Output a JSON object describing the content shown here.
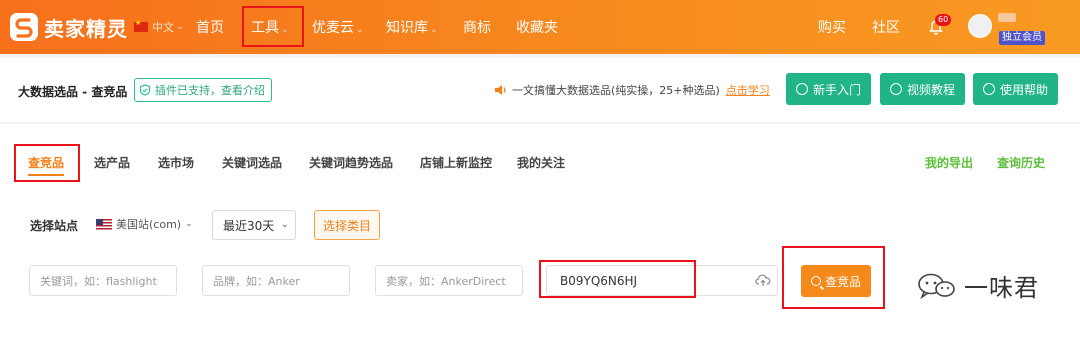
{
  "brand": {
    "name": "卖家精灵"
  },
  "topnav": {
    "language": "中文",
    "items": [
      {
        "label": "首页",
        "has_caret": false
      },
      {
        "label": "工具",
        "has_caret": true
      },
      {
        "label": "优麦云",
        "has_caret": true
      },
      {
        "label": "知识库",
        "has_caret": true
      },
      {
        "label": "商标",
        "has_caret": false
      },
      {
        "label": "收藏夹",
        "has_caret": false
      }
    ],
    "right_items": [
      {
        "label": "购买"
      },
      {
        "label": "社区"
      }
    ],
    "notification_count": "60",
    "member_tag": "独立会员"
  },
  "subheader": {
    "title": "大数据选品 - 查竞品",
    "plugin_tag": "插件已支持，查看介绍",
    "promo_text": "一文搞懂大数据选品(纯实操，25+种选品)",
    "promo_link": "点击学习",
    "buttons": [
      {
        "label": "新手入门",
        "icon": "send-icon"
      },
      {
        "label": "视频教程",
        "icon": "play-icon"
      },
      {
        "label": "使用帮助",
        "icon": "help-icon"
      }
    ]
  },
  "tabs": {
    "items": [
      {
        "label": "查竞品",
        "active": true
      },
      {
        "label": "选产品",
        "active": false
      },
      {
        "label": "选市场",
        "active": false
      },
      {
        "label": "关键词选品",
        "active": false
      },
      {
        "label": "关键词趋势选品",
        "active": false
      },
      {
        "label": "店铺上新监控",
        "active": false
      },
      {
        "label": "我的关注",
        "active": false
      }
    ],
    "right": [
      {
        "label": "我的导出"
      },
      {
        "label": "查询历史"
      }
    ]
  },
  "filters": {
    "station_label": "选择站点",
    "station_value": "美国站(com)",
    "time_value": "最近30天",
    "category_button": "选择类目"
  },
  "search": {
    "keyword_placeholder": "关键词，如：flashlight",
    "brand_placeholder": "品牌，如：Anker",
    "seller_placeholder": "卖家，如：AnkerDirect",
    "asin_value": "B09YQ6N6HJ",
    "button_label": "查竞品"
  },
  "watermark": {
    "text": "一味君"
  },
  "colors": {
    "brand_orange": "#f7701c",
    "accent_orange": "#f48018",
    "green": "#20b486",
    "highlight_red": "#e8141a"
  }
}
